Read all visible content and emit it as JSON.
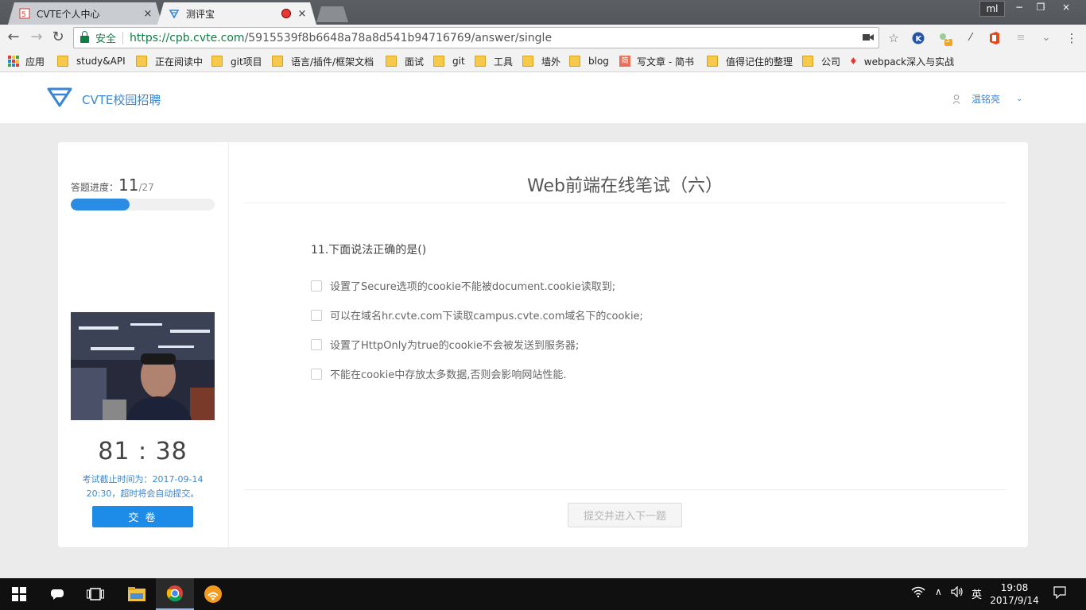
{
  "browser": {
    "tabs": [
      {
        "title": "CVTE个人中心",
        "close": "×"
      },
      {
        "title": "测评宝",
        "close": "×"
      }
    ],
    "profile": "ml",
    "window_controls": {
      "minimize": "−",
      "maximize": "❐",
      "close": "×"
    },
    "security_label": "安全",
    "url_host": "https://cpb.cvte.com",
    "url_path": "/5915539f8b6648a78a8d541b94716769/answer/single",
    "extension_badge": "3",
    "bookmarks": [
      "应用",
      "study&API",
      "正在阅读中",
      "git项目",
      "语言/插件/框架文档",
      "面试",
      "git",
      "工具",
      "墙外",
      "blog",
      "写文章 - 简书",
      "值得记住的整理",
      "公司",
      "webpack深入与实战"
    ]
  },
  "site": {
    "logo_text": "CVTE校园招聘",
    "user_name": "温铭亮"
  },
  "exam": {
    "progress_label": "答题进度：",
    "progress_current": "11",
    "progress_total": "/27",
    "progress_fraction": 0.407,
    "timer": "81 : 38",
    "deadline_line1": "考试截止时间为：2017-09-14",
    "deadline_line2": "20:30，超时将会自动提交。",
    "submit_paper": "交 卷",
    "title": "Web前端在线笔试（六）",
    "question": "11.下面说法正确的是()",
    "options": [
      "设置了Secure选项的cookie不能被document.cookie读取到;",
      "可以在域名hr.cvte.com下读取campus.cvte.com域名下的cookie;",
      "设置了HttpOnly为true的cookie不会被发送到服务器;",
      "不能在cookie中存放太多数据,否则会影响网站性能."
    ],
    "next_button": "提交并进入下一题"
  },
  "taskbar": {
    "ime": "英",
    "time": "19:08",
    "date": "2017/9/14"
  },
  "colors": {
    "accent_blue": "#1d8ce8",
    "secure_green": "#0b8043"
  }
}
